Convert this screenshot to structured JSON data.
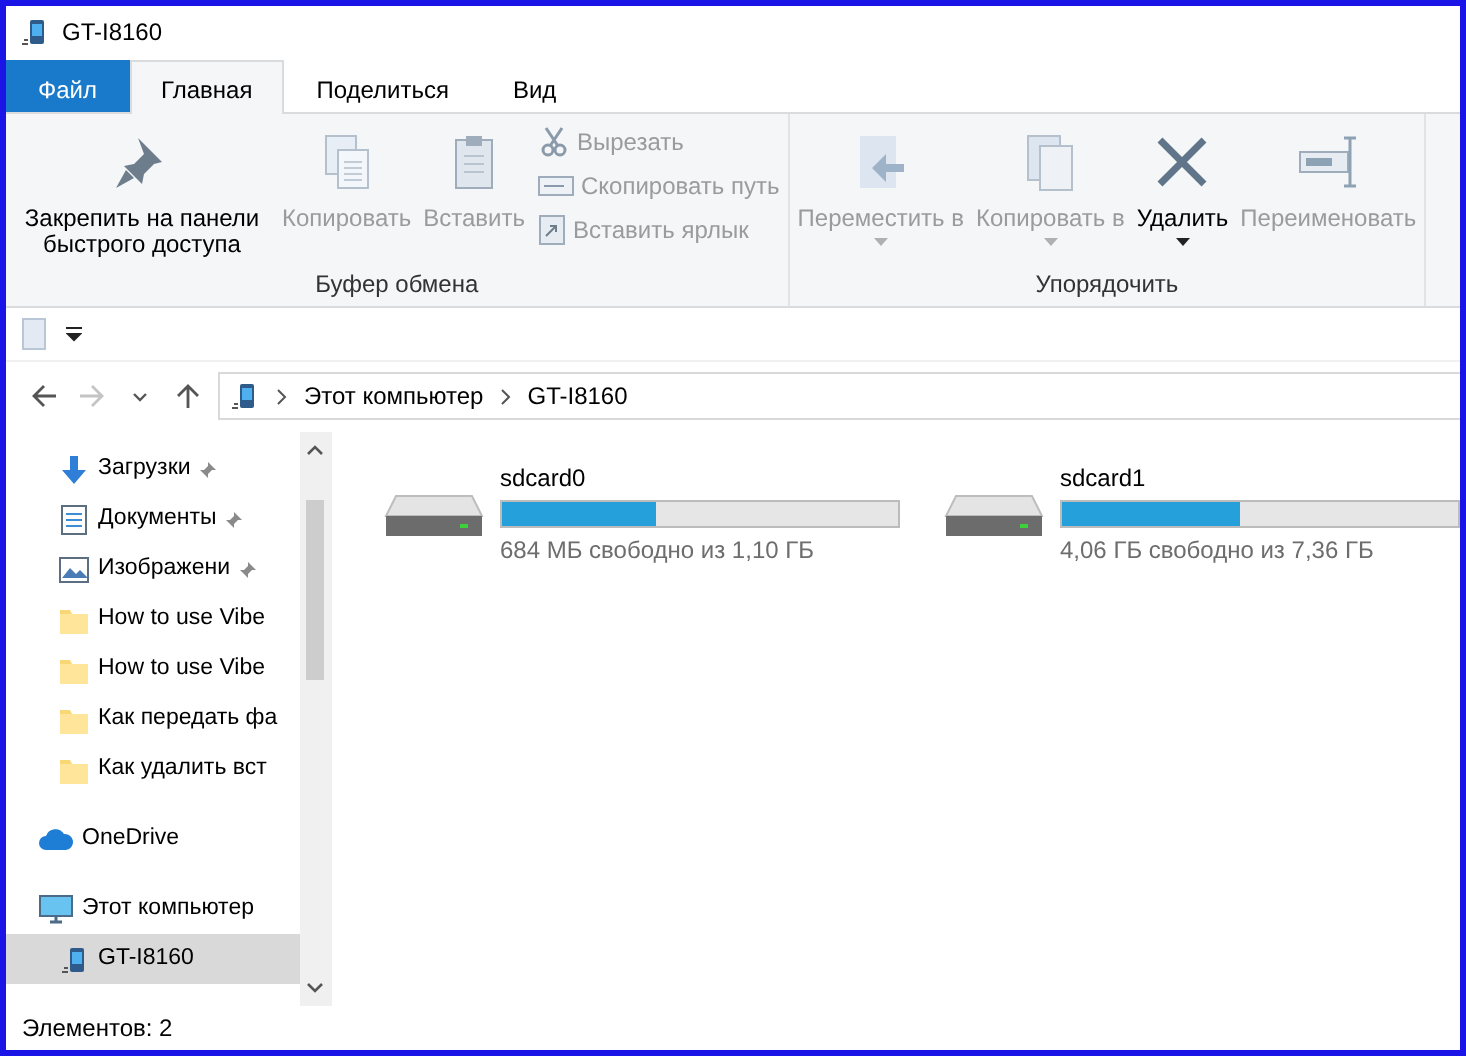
{
  "window": {
    "title": "GT-I8160"
  },
  "tabs": [
    {
      "label": "Файл",
      "kind": "file",
      "selected": false
    },
    {
      "label": "Главная",
      "kind": "tab",
      "selected": true
    },
    {
      "label": "Поделиться",
      "kind": "tab",
      "selected": false
    },
    {
      "label": "Вид",
      "kind": "tab",
      "selected": false
    }
  ],
  "ribbon": {
    "groups": [
      {
        "label": "Буфер обмена",
        "large": [
          {
            "label": "Закрепить на панели быстрого доступа",
            "kind": "pin",
            "disabled": false,
            "dropdown": false
          },
          {
            "label": "Копировать",
            "kind": "copy",
            "disabled": true,
            "dropdown": false
          },
          {
            "label": "Вставить",
            "kind": "paste",
            "disabled": true,
            "dropdown": false
          }
        ],
        "small": [
          {
            "label": "Вырезать",
            "kind": "cut",
            "disabled": true
          },
          {
            "label": "Скопировать путь",
            "kind": "path",
            "disabled": true
          },
          {
            "label": "Вставить ярлык",
            "kind": "shortcut",
            "disabled": true
          }
        ]
      },
      {
        "label": "Упорядочить",
        "large": [
          {
            "label": "Переместить в",
            "kind": "move",
            "disabled": true,
            "dropdown": true
          },
          {
            "label": "Копировать в",
            "kind": "copyto",
            "disabled": true,
            "dropdown": true
          },
          {
            "label": "Удалить",
            "kind": "delete",
            "disabled": false,
            "dropdown": true
          },
          {
            "label": "Переименовать",
            "kind": "rename",
            "disabled": true,
            "dropdown": false
          }
        ]
      }
    ]
  },
  "navigation": {
    "back_disabled": false,
    "forward_disabled": true
  },
  "address": {
    "crumbs": [
      "Этот компьютер",
      "GT-I8160"
    ]
  },
  "sidebar": {
    "items": [
      {
        "label": "Загрузки",
        "kind": "download",
        "pinned": true,
        "selected": false
      },
      {
        "label": "Документы",
        "kind": "document",
        "pinned": true,
        "selected": false
      },
      {
        "label": "Изображени",
        "kind": "picture",
        "pinned": true,
        "selected": false
      },
      {
        "label": "How to use Vibe",
        "kind": "folder",
        "pinned": false,
        "selected": false
      },
      {
        "label": "How to use Vibe",
        "kind": "folder",
        "pinned": false,
        "selected": false
      },
      {
        "label": "Как передать фа",
        "kind": "folder",
        "pinned": false,
        "selected": false
      },
      {
        "label": "Как удалить вст",
        "kind": "folder",
        "pinned": false,
        "selected": false
      },
      {
        "label": "OneDrive",
        "kind": "cloud",
        "pinned": false,
        "selected": false
      },
      {
        "label": "Этот компьютер",
        "kind": "computer",
        "pinned": false,
        "selected": false,
        "children": [
          {
            "label": "GT-I8160",
            "kind": "phone",
            "pinned": false,
            "selected": true
          }
        ]
      }
    ]
  },
  "drives": [
    {
      "name": "sdcard0",
      "level": 0.39,
      "info": "684 МБ свободно из 1,10 ГБ"
    },
    {
      "name": "sdcard1",
      "level": 0.45,
      "info": "4,06 ГБ свободно из 7,36 ГБ"
    }
  ],
  "status_bar": {
    "text": "Элементов: 2"
  }
}
